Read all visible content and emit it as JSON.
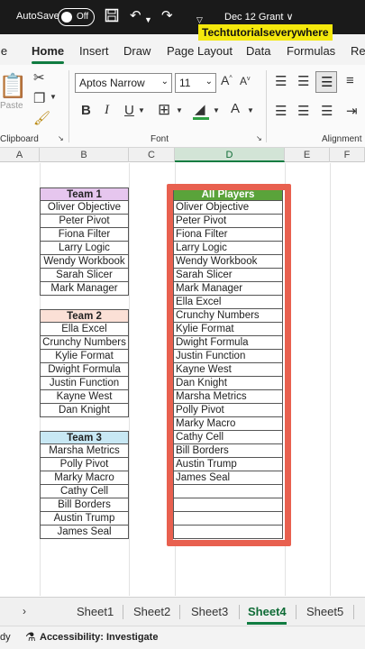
{
  "titlebar": {
    "autosave_label": "AutoSave",
    "toggle_state": "Off",
    "doc_title": "Dec 12 Grant ∨",
    "overlay_watermark": "Techtutorialseverywhere"
  },
  "ribbon_tabs": [
    "le",
    "Home",
    "Insert",
    "Draw",
    "Page Layout",
    "Data",
    "Formulas",
    "Rev"
  ],
  "ribbon": {
    "font_name": "Aptos Narrow",
    "font_size": "11",
    "paste_label": "Paste",
    "clipboard_label": "Clipboard",
    "font_label": "Font",
    "alignment_label": "Alignment",
    "bold": "B",
    "italic": "I",
    "underline": "U",
    "font_color_letter": "A",
    "font_grow": "A",
    "font_shrink": "A",
    "clear_letter": "A"
  },
  "columns": [
    "A",
    "B",
    "C",
    "D",
    "E",
    "F"
  ],
  "team1": {
    "header": "Team 1",
    "header_color": "#e6c6ee",
    "members": [
      "Oliver Objective",
      "Peter Pivot",
      "Fiona Filter",
      "Larry Logic",
      "Wendy Workbook",
      "Sarah Slicer",
      "Mark Manager"
    ]
  },
  "team2": {
    "header": "Team 2",
    "header_color": "#fbe0d6",
    "members": [
      "Ella Excel",
      "Crunchy Numbers",
      "Kylie Format",
      "Dwight Formula",
      "Justin Function",
      "Kayne West",
      "Dan Knight"
    ]
  },
  "team3": {
    "header": "Team 3",
    "header_color": "#c8e8f4",
    "members": [
      "Marsha Metrics",
      "Polly Pivot",
      "Marky Macro",
      "Cathy Cell",
      "Bill Borders",
      "Austin Trump",
      "James Seal"
    ]
  },
  "all_players": {
    "header": "All Players",
    "header_color": "#5aa33a",
    "highlight_color": "#e8604f",
    "members": [
      "Oliver Objective",
      "Peter Pivot",
      "Fiona Filter",
      "Larry Logic",
      "Wendy Workbook",
      "Sarah Slicer",
      "Mark Manager",
      "Ella Excel",
      "Crunchy Numbers",
      "Kylie Format",
      "Dwight Formula",
      "Justin Function",
      "Kayne West",
      "Dan Knight",
      "Marsha Metrics",
      "Polly Pivot",
      "Marky Macro",
      "Cathy Cell",
      "Bill Borders",
      "Austin Trump",
      "James Seal",
      "",
      "",
      "",
      ""
    ]
  },
  "sheets": [
    "Sheet1",
    "Sheet2",
    "Sheet3",
    "Sheet4",
    "Sheet5"
  ],
  "active_sheet": "Sheet4",
  "statusbar": {
    "ready_fragment": "dy",
    "accessibility": "Accessibility: Investigate"
  }
}
